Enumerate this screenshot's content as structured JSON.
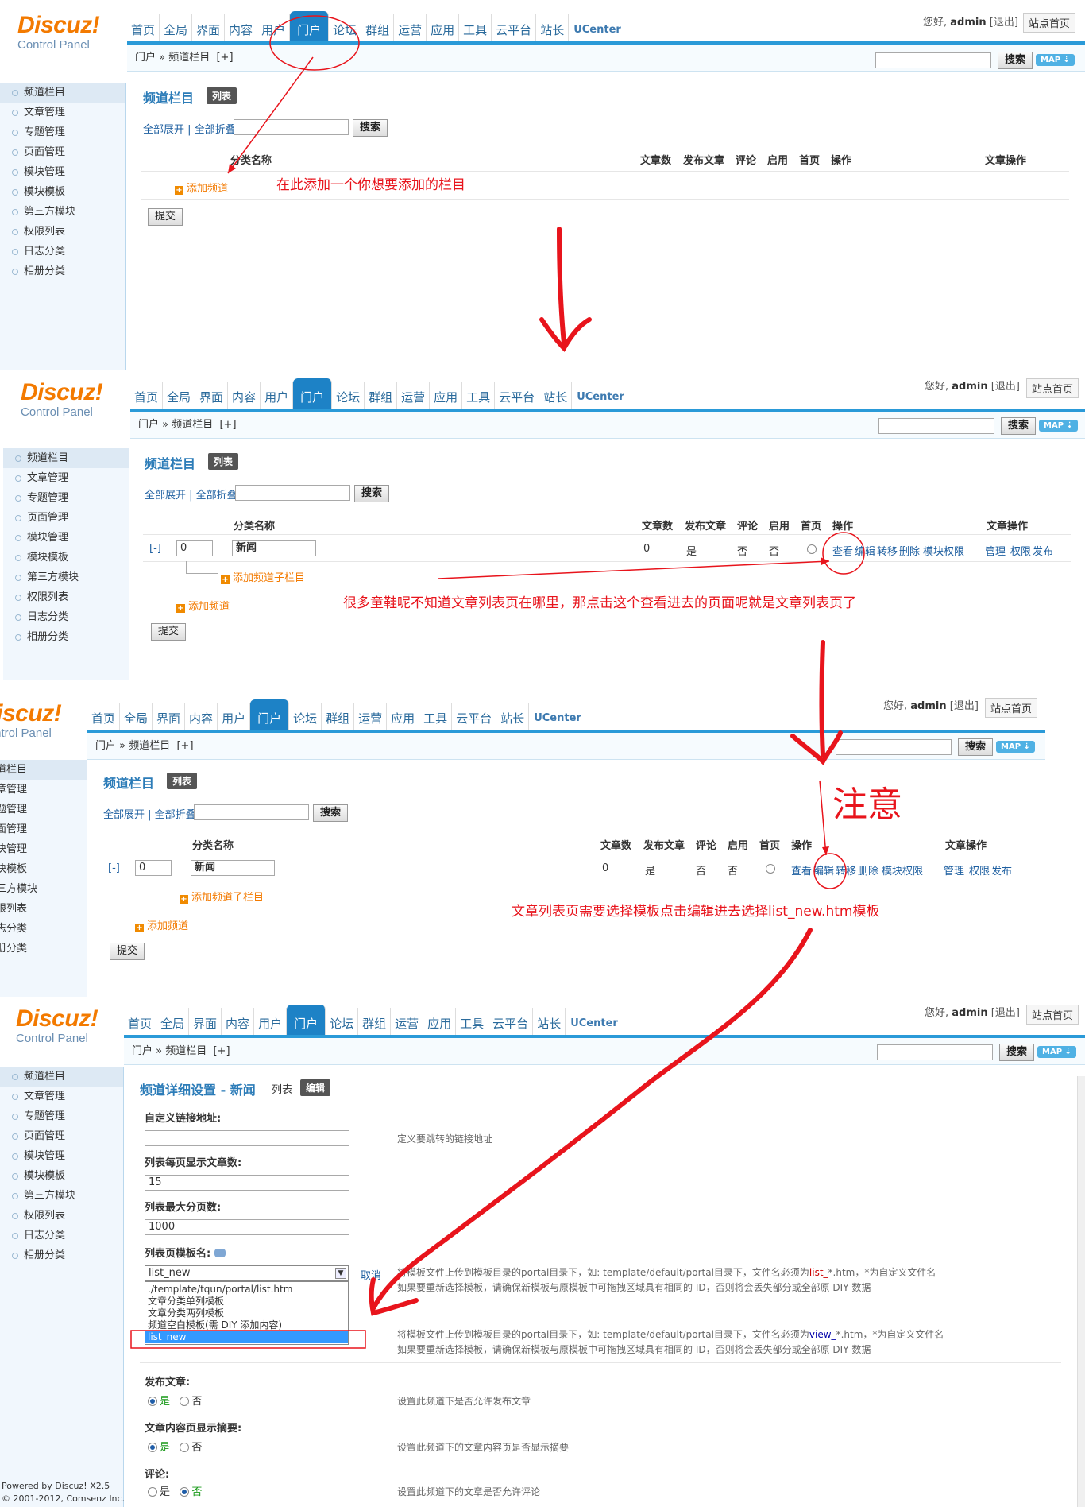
{
  "header": {
    "logo_main": "Discuz!",
    "logo_sub": "Control Panel",
    "nav": [
      "首页",
      "全局",
      "界面",
      "内容",
      "用户",
      "门户",
      "论坛",
      "群组",
      "运营",
      "应用",
      "工具",
      "云平台",
      "站长"
    ],
    "ucenter": "UCenter",
    "greeting": "您好,",
    "username": "admin",
    "logout": "[退出]",
    "site_home": "站点首页",
    "search_btn": "搜索",
    "map_btn": "MAP ⇣"
  },
  "breadcrumb": "门户 » 频道栏目",
  "breadcrumb_add": "[+]",
  "sidebar": [
    "频道栏目",
    "文章管理",
    "专题管理",
    "页面管理",
    "模块管理",
    "模块模板",
    "第三方模块",
    "权限列表",
    "日志分类",
    "相册分类"
  ],
  "list": {
    "title": "频道栏目",
    "tab": "列表",
    "expand_all": "全部展开",
    "collapse_all": "全部折叠",
    "search_btn": "搜索",
    "headers": {
      "name": "分类名称",
      "count": "文章数",
      "publish": "发布文章",
      "comment": "评论",
      "enabled": "启用",
      "home": "首页",
      "ops": "操作",
      "article_ops": "文章操作"
    },
    "add_channel": "添加频道",
    "add_sub": "添加频道子栏目",
    "submit": "提交",
    "row": {
      "toggle": "[-]",
      "order": "0",
      "name": "新闻",
      "count": "0",
      "publish": "是",
      "comment": "否",
      "enabled": "否"
    },
    "row_ops": [
      "查看",
      "编辑",
      "转移",
      "删除",
      "模块权限"
    ],
    "row_article_ops": [
      "管理",
      "权限",
      "发布"
    ]
  },
  "annotations": {
    "a1": "在此添加一个你想要添加的栏目",
    "a2": "很多童鞋呢不知道文章列表页在哪里，那点击这个查看进去的页面呢就是文章列表页了",
    "a3_big": "注意",
    "a3": "文章列表页需要选择模板点击编辑进去选择list_new.htm模板"
  },
  "detail": {
    "title": "频道详细设置 - 新闻",
    "tab_list": "列表",
    "tab_edit": "编辑",
    "custom_url_label": "自定义链接地址:",
    "custom_url_hint": "定义要跳转的链接地址",
    "per_page_label": "列表每页显示文章数:",
    "per_page_value": "15",
    "max_pages_label": "列表最大分页数:",
    "max_pages_value": "1000",
    "tpl_label": "列表页模板名:",
    "tpl_selected": "list_new",
    "tpl_cancel": "取消",
    "tpl_options": [
      "./template/tqun/portal/list.htm",
      "文章分类单列模板",
      "文章分类两列模板",
      "频道空白模板(需 DIY 添加内容)",
      "list_new"
    ],
    "tpl_hint1_pre": "将模板文件上传到模板目录的portal目录下，如: template/default/portal目录下，文件名必须为",
    "tpl_hint1_key": "list_",
    "tpl_hint1_post": "*.htm，*为自定义文件名",
    "tpl_hint2": "如果要重新选择模板，请确保新模板与原模板中可拖拽区域具有相同的 ID，否则将会丢失部分或全部原 DIY 数据",
    "view_hint1_pre": "将模板文件上传到模板目录的portal目录下，如: template/default/portal目录下，文件名必须为",
    "view_hint1_key": "view_",
    "view_hint1_post": "*.htm，*为自定义文件名",
    "view_hint2": "如果要重新选择模板，请确保新模板与原模板中可拖拽区域具有相同的 ID，否则将会丢失部分或全部原 DIY 数据",
    "publish_label": "发布文章:",
    "publish_hint": "设置此频道下是否允许发布文章",
    "summary_label": "文章内容页显示摘要:",
    "summary_hint": "设置此频道下的文章内容页是否显示摘要",
    "comment_label": "评论:",
    "comment_hint": "设置此频道下的文章是否允许评论",
    "yes": "是",
    "no": "否"
  },
  "footer": {
    "powered": "Powered by Discuz! X2.5",
    "copyright": "© 2001-2012, Comsenz Inc."
  }
}
